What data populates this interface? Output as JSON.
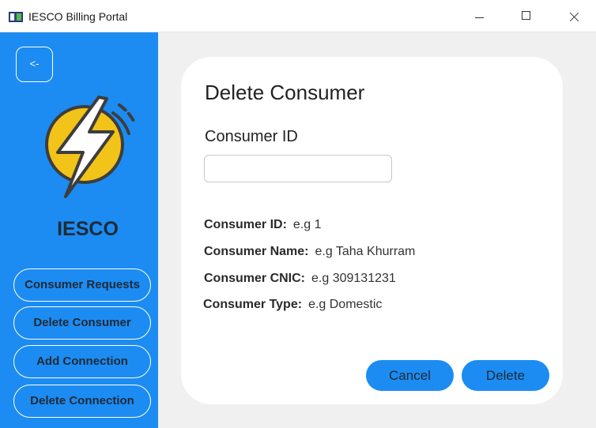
{
  "window": {
    "title": "IESCO Billing Portal"
  },
  "sidebar": {
    "back_label": "<-",
    "brand": "IESCO",
    "nav": [
      {
        "label": "Consumer Requests"
      },
      {
        "label": "Delete Consumer"
      },
      {
        "label": "Add Connection"
      },
      {
        "label": "Delete Connection"
      }
    ]
  },
  "main": {
    "title": "Delete Consumer",
    "consumer_id_label": "Consumer ID",
    "consumer_id_value": "",
    "info": [
      {
        "key": "Consumer ID:",
        "value": "e.g 1"
      },
      {
        "key": "Consumer Name:",
        "value": "e.g Taha Khurram"
      },
      {
        "key": "Consumer CNIC:",
        "value": "e.g 309131231"
      },
      {
        "key": "Consumer Type:",
        "value": "e.g Domestic"
      }
    ],
    "cancel_label": "Cancel",
    "delete_label": "Delete"
  },
  "colors": {
    "sidebar": "#1c8cf2",
    "button": "#1c8cf2",
    "logo_circle": "#f2c318",
    "logo_outline": "#3d3d3d"
  },
  "icons": [
    "app-icon",
    "minimize-icon",
    "maximize-icon",
    "close-icon",
    "lightning-logo"
  ]
}
